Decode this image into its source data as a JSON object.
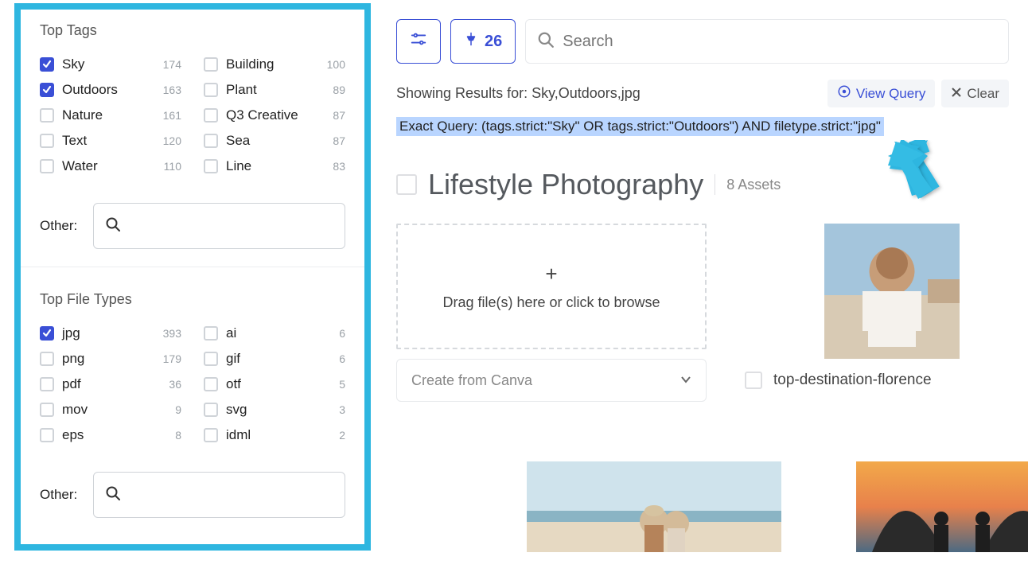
{
  "sidebar": {
    "tags_title": "Top Tags",
    "filetypes_title": "Top File Types",
    "other_label": "Other:",
    "tags_left": [
      {
        "label": "Sky",
        "count": "174",
        "checked": true
      },
      {
        "label": "Outdoors",
        "count": "163",
        "checked": true
      },
      {
        "label": "Nature",
        "count": "161",
        "checked": false
      },
      {
        "label": "Text",
        "count": "120",
        "checked": false
      },
      {
        "label": "Water",
        "count": "110",
        "checked": false
      }
    ],
    "tags_right": [
      {
        "label": "Building",
        "count": "100",
        "checked": false
      },
      {
        "label": "Plant",
        "count": "89",
        "checked": false
      },
      {
        "label": "Q3 Creative",
        "count": "87",
        "checked": false
      },
      {
        "label": "Sea",
        "count": "87",
        "checked": false
      },
      {
        "label": "Line",
        "count": "83",
        "checked": false
      }
    ],
    "ft_left": [
      {
        "label": "jpg",
        "count": "393",
        "checked": true
      },
      {
        "label": "png",
        "count": "179",
        "checked": false
      },
      {
        "label": "pdf",
        "count": "36",
        "checked": false
      },
      {
        "label": "mov",
        "count": "9",
        "checked": false
      },
      {
        "label": "eps",
        "count": "8",
        "checked": false
      }
    ],
    "ft_right": [
      {
        "label": "ai",
        "count": "6",
        "checked": false
      },
      {
        "label": "gif",
        "count": "6",
        "checked": false
      },
      {
        "label": "otf",
        "count": "5",
        "checked": false
      },
      {
        "label": "svg",
        "count": "3",
        "checked": false
      },
      {
        "label": "idml",
        "count": "2",
        "checked": false
      }
    ]
  },
  "topbar": {
    "pin_count": "26",
    "search_placeholder": "Search"
  },
  "results": {
    "showing_label_prefix": "Showing Results for: ",
    "showing_value": "Sky,Outdoors,jpg",
    "view_query": "View Query",
    "clear": "Clear",
    "exact_label": "Exact Query: ",
    "exact_value": "(tags.strict:\"Sky\" OR tags.strict:\"Outdoors\") AND filetype.strict:\"jpg\""
  },
  "section": {
    "name": "Lifestyle Photography",
    "asset_count": "8 Assets"
  },
  "drop": {
    "text": "Drag file(s) here or click to browse",
    "canva": "Create from Canva"
  },
  "asset1": {
    "name": "top-destination-florence"
  }
}
